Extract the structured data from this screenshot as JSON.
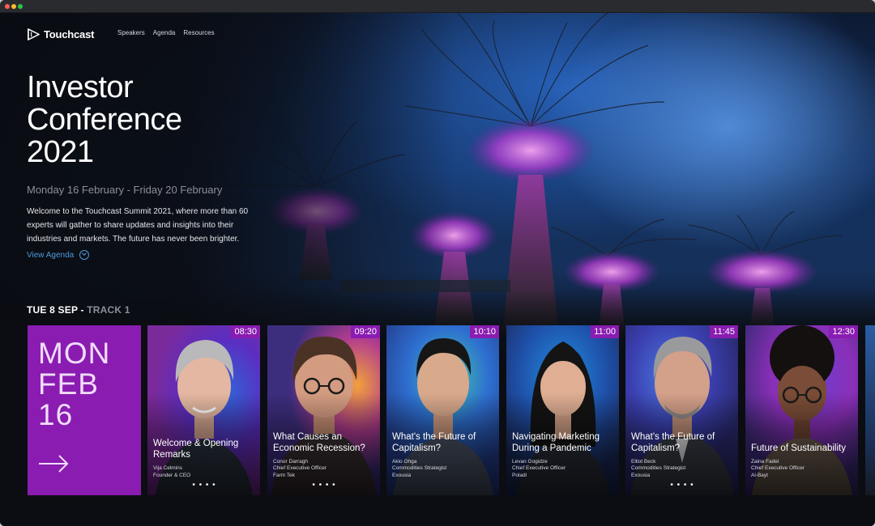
{
  "brand": {
    "name": "Touchcast"
  },
  "nav": {
    "links": [
      "Speakers",
      "Agenda",
      "Resources"
    ]
  },
  "hero": {
    "title_lines": [
      "Investor",
      "Conference",
      "2021"
    ],
    "dates": "Monday 16 February - Friday 20 February",
    "description": "Welcome to the Touchcast Summit 2021, where more than 60 experts will gather to share updates and insights into their industries and markets. The future has never been brighter.",
    "cta": "View Agenda"
  },
  "track": {
    "day": "TUE 8 SEP",
    "separator": " - ",
    "name": "TRACK 1"
  },
  "date_card": {
    "line1": "MON",
    "line2": "FEB",
    "line3": "16"
  },
  "colors": {
    "accent": "#8a1cb1",
    "link": "#4c9ad8",
    "background": "#0b0d12"
  },
  "sessions": [
    {
      "time": "08:30",
      "title": "Welcome & Opening Remarks",
      "speaker_name": "Vija Celmins",
      "speaker_role": "Founder & CEO",
      "speaker_company": "",
      "dots": "• • • •"
    },
    {
      "time": "09:20",
      "title": "What Causes an Economic Recession?",
      "speaker_name": "Conor Darragh",
      "speaker_role": "Chief Executive Officer",
      "speaker_company": "Farm Tek",
      "dots": "• • • •"
    },
    {
      "time": "10:10",
      "title": "What's the Future of Capitalism?",
      "speaker_name": "Akio Ohga",
      "speaker_role": "Commodities Strategist",
      "speaker_company": "Exousia",
      "dots": ""
    },
    {
      "time": "11:00",
      "title": "Navigating Marketing During a Pandemic",
      "speaker_name": "Levan Gogidze",
      "speaker_role": "Chief Executive Officer",
      "speaker_company": "Poladi",
      "dots": ""
    },
    {
      "time": "11:45",
      "title": "What's the Future of Capitalism?",
      "speaker_name": "Elliot Beck",
      "speaker_role": "Commodities Strategist",
      "speaker_company": "Exousia",
      "dots": "• • • •"
    },
    {
      "time": "12:30",
      "title": "Future of Sustainability",
      "speaker_name": "Zaina Fadel",
      "speaker_role": "Chief Executive Officer",
      "speaker_company": "Al-Bayt",
      "dots": ""
    }
  ]
}
